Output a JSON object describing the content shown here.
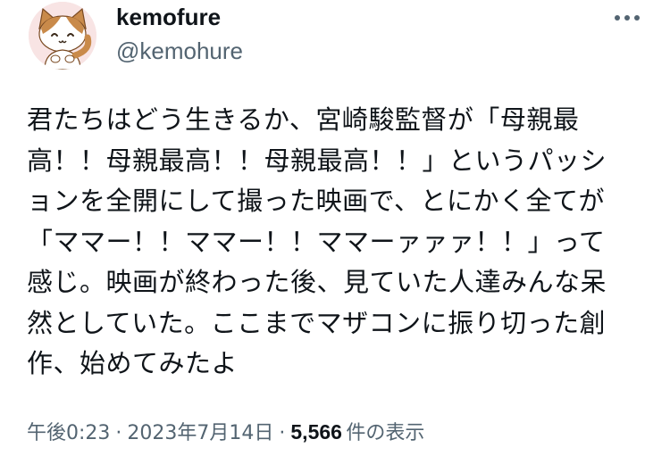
{
  "author": {
    "display_name": "kemofure",
    "handle": "@kemohure",
    "avatar_icon": "cat-avatar-icon"
  },
  "more_icon": "more-dots-icon",
  "tweet": {
    "lines": [
      "君たちはどう生きるか、宮崎駿監督が「母親最",
      "高！！母親最高！！母親最高！！」というパッシ",
      "ョンを全開にして撮った映画で、とにかく全てが",
      "「ママー！！ママー！！ママーァァァ！！」って",
      "感じ。映画が終わった後、見ていた人達みんな呆",
      "然としていた。ここまでマザコンに振り切った創",
      "作、始めてみたよ"
    ]
  },
  "meta": {
    "time": "午後0:23",
    "separator": "·",
    "date": "2023年7月14日",
    "views_count": "5,566",
    "views_label": "件の表示"
  },
  "colors": {
    "text_primary": "#0f1419",
    "text_secondary": "#536471",
    "avatar_bg": "#f7e6e6"
  }
}
